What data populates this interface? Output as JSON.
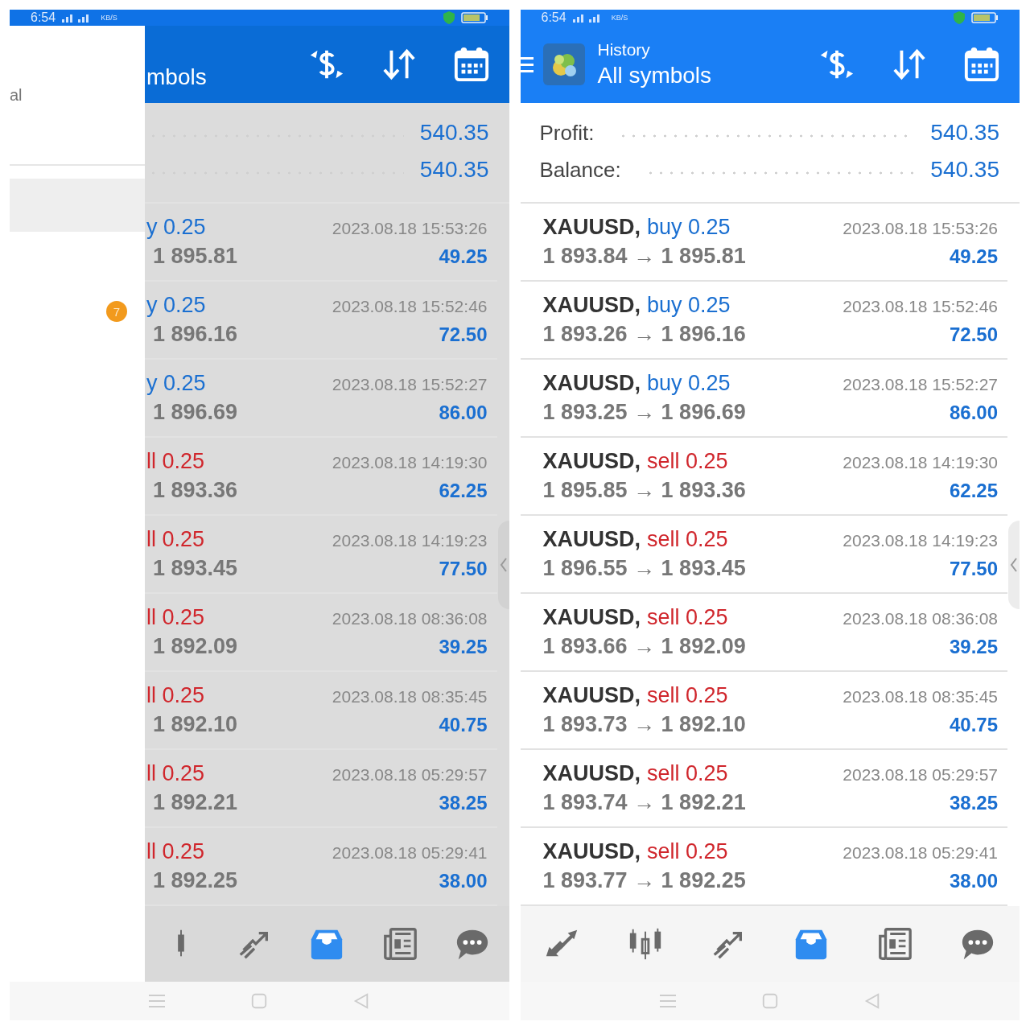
{
  "screens": [
    {
      "dimmed": true,
      "status": {
        "time": "6:54",
        "speed": "KB/S"
      },
      "drawer": {
        "label": "al",
        "badge": "7"
      },
      "header": {
        "title": "mbols"
      },
      "summary": [
        {
          "value": "540.35"
        },
        {
          "value": "540.35"
        }
      ],
      "deals": [
        {
          "kind": "buy",
          "trade": "y 0.25",
          "prices": "1 895.81",
          "time": "2023.08.18 15:53:26",
          "profit": "49.25"
        },
        {
          "kind": "buy",
          "trade": "y 0.25",
          "prices": "1 896.16",
          "time": "2023.08.18 15:52:46",
          "profit": "72.50"
        },
        {
          "kind": "buy",
          "trade": "y 0.25",
          "prices": "1 896.69",
          "time": "2023.08.18 15:52:27",
          "profit": "86.00"
        },
        {
          "kind": "sell",
          "trade": "ll 0.25",
          "prices": "1 893.36",
          "time": "2023.08.18 14:19:30",
          "profit": "62.25"
        },
        {
          "kind": "sell",
          "trade": "ll 0.25",
          "prices": "1 893.45",
          "time": "2023.08.18 14:19:23",
          "profit": "77.50"
        },
        {
          "kind": "sell",
          "trade": "ll 0.25",
          "prices": "1 892.09",
          "time": "2023.08.18 08:36:08",
          "profit": "39.25"
        },
        {
          "kind": "sell",
          "trade": "ll 0.25",
          "prices": "1 892.10",
          "time": "2023.08.18 08:35:45",
          "profit": "40.75"
        },
        {
          "kind": "sell",
          "trade": "ll 0.25",
          "prices": "1 892.21",
          "time": "2023.08.18 05:29:57",
          "profit": "38.25"
        },
        {
          "kind": "sell",
          "trade": "ll 0.25",
          "prices": "1 892.25",
          "time": "2023.08.18 05:29:41",
          "profit": "38.00"
        }
      ],
      "nav": [
        {
          "kind": "candle",
          "selected": false
        },
        {
          "kind": "chart",
          "selected": false
        },
        {
          "kind": "history",
          "selected": true
        },
        {
          "kind": "news",
          "selected": false
        },
        {
          "kind": "chat",
          "selected": false
        }
      ]
    },
    {
      "dimmed": false,
      "status": {
        "time": "6:54",
        "speed": "KB/S"
      },
      "header": {
        "subtitle": "History",
        "title": "All symbols"
      },
      "summary": [
        {
          "label": "Profit:",
          "value": "540.35"
        },
        {
          "label": "Balance:",
          "value": "540.35"
        }
      ],
      "deals": [
        {
          "symbol": "XAUUSD,",
          "kind": "buy",
          "trade": "buy 0.25",
          "prices": "1 893.84 → 1 895.81",
          "time": "2023.08.18 15:53:26",
          "profit": "49.25"
        },
        {
          "symbol": "XAUUSD,",
          "kind": "buy",
          "trade": "buy 0.25",
          "prices": "1 893.26 → 1 896.16",
          "time": "2023.08.18 15:52:46",
          "profit": "72.50"
        },
        {
          "symbol": "XAUUSD,",
          "kind": "buy",
          "trade": "buy 0.25",
          "prices": "1 893.25 → 1 896.69",
          "time": "2023.08.18 15:52:27",
          "profit": "86.00"
        },
        {
          "symbol": "XAUUSD,",
          "kind": "sell",
          "trade": "sell 0.25",
          "prices": "1 895.85 → 1 893.36",
          "time": "2023.08.18 14:19:30",
          "profit": "62.25"
        },
        {
          "symbol": "XAUUSD,",
          "kind": "sell",
          "trade": "sell 0.25",
          "prices": "1 896.55 → 1 893.45",
          "time": "2023.08.18 14:19:23",
          "profit": "77.50"
        },
        {
          "symbol": "XAUUSD,",
          "kind": "sell",
          "trade": "sell 0.25",
          "prices": "1 893.66 → 1 892.09",
          "time": "2023.08.18 08:36:08",
          "profit": "39.25"
        },
        {
          "symbol": "XAUUSD,",
          "kind": "sell",
          "trade": "sell 0.25",
          "prices": "1 893.73 → 1 892.10",
          "time": "2023.08.18 08:35:45",
          "profit": "40.75"
        },
        {
          "symbol": "XAUUSD,",
          "kind": "sell",
          "trade": "sell 0.25",
          "prices": "1 893.74 → 1 892.21",
          "time": "2023.08.18 05:29:57",
          "profit": "38.25"
        },
        {
          "symbol": "XAUUSD,",
          "kind": "sell",
          "trade": "sell 0.25",
          "prices": "1 893.77 → 1 892.25",
          "time": "2023.08.18 05:29:41",
          "profit": "38.00"
        }
      ],
      "nav": [
        {
          "kind": "trade",
          "selected": false
        },
        {
          "kind": "quotes",
          "selected": false
        },
        {
          "kind": "chart",
          "selected": false
        },
        {
          "kind": "history",
          "selected": true
        },
        {
          "kind": "news",
          "selected": false
        },
        {
          "kind": "chat",
          "selected": false
        }
      ]
    }
  ]
}
